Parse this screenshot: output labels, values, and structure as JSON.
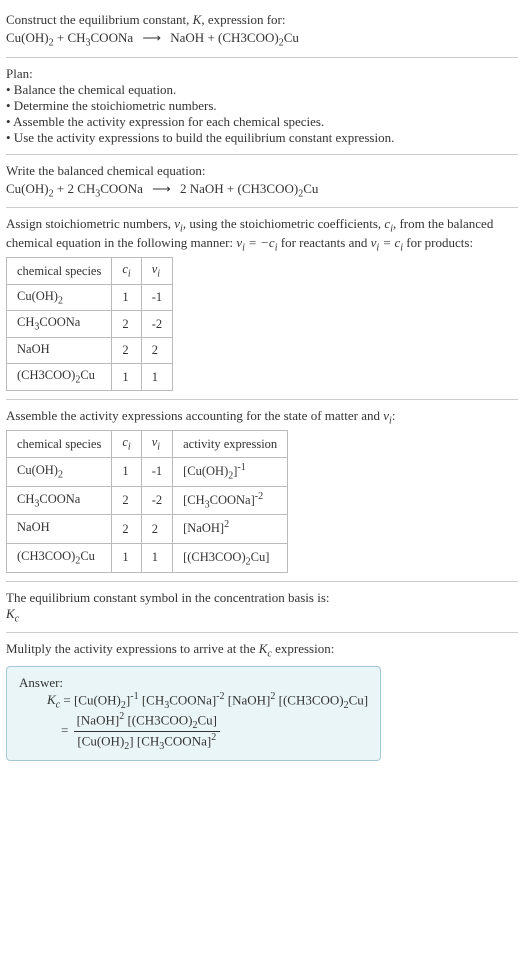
{
  "header": {
    "line1_a": "Construct the equilibrium constant, ",
    "line1_b": ", expression for:"
  },
  "eq1": {
    "lhs1": "Cu(OH)",
    "lhs1_sub": "2",
    "plus1": " + ",
    "lhs2": "CH",
    "lhs2_sub": "3",
    "lhs2b": "COONa",
    "arrow": "⟶",
    "rhs1": "NaOH + (CH3COO)",
    "rhs1_sub": "2",
    "rhs1b": "Cu"
  },
  "plan_title": "Plan:",
  "plan_items": {
    "a": "• Balance the chemical equation.",
    "b": "• Determine the stoichiometric numbers.",
    "c": "• Assemble the activity expression for each chemical species.",
    "d": "• Use the activity expressions to build the equilibrium constant expression."
  },
  "balanced_title": "Write the balanced chemical equation:",
  "eq2": {
    "lhs1": "Cu(OH)",
    "lhs1_sub": "2",
    "plus1": " + 2 CH",
    "lhs2_sub": "3",
    "lhs2b": "COONa",
    "arrow": "⟶",
    "rhs": "2 NaOH + (CH3COO)",
    "rhs_sub": "2",
    "rhsb": "Cu"
  },
  "assign_text_a": "Assign stoichiometric numbers, ",
  "assign_text_b": ", using the stoichiometric coefficients, ",
  "assign_text_c": ", from the balanced chemical equation in the following manner: ",
  "assign_text_d": " for reactants and ",
  "assign_text_e": " for products:",
  "table1": {
    "h1": "chemical species",
    "h2": "c",
    "h2_sub": "i",
    "h3": "ν",
    "h3_sub": "i",
    "rows": [
      {
        "sp_a": "Cu(OH)",
        "sp_sub": "2",
        "sp_b": "",
        "c": "1",
        "v": "-1"
      },
      {
        "sp_a": "CH",
        "sp_sub": "3",
        "sp_b": "COONa",
        "c": "2",
        "v": "-2"
      },
      {
        "sp_a": "NaOH",
        "sp_sub": "",
        "sp_b": "",
        "c": "2",
        "v": "2"
      },
      {
        "sp_a": "(CH3COO)",
        "sp_sub": "2",
        "sp_b": "Cu",
        "c": "1",
        "v": "1"
      }
    ]
  },
  "activity_title_a": "Assemble the activity expressions accounting for the state of matter and ",
  "activity_title_b": ":",
  "table2": {
    "h1": "chemical species",
    "h4": "activity expression",
    "rows": [
      {
        "sp_a": "Cu(OH)",
        "sp_sub": "2",
        "sp_b": "",
        "c": "1",
        "v": "-1",
        "act_a": "[Cu(OH)",
        "act_sub": "2",
        "act_b": "]",
        "exp": "-1"
      },
      {
        "sp_a": "CH",
        "sp_sub": "3",
        "sp_b": "COONa",
        "c": "2",
        "v": "-2",
        "act_a": "[CH",
        "act_sub": "3",
        "act_b": "COONa]",
        "exp": "-2"
      },
      {
        "sp_a": "NaOH",
        "sp_sub": "",
        "sp_b": "",
        "c": "2",
        "v": "2",
        "act_a": "[NaOH]",
        "act_sub": "",
        "act_b": "",
        "exp": "2"
      },
      {
        "sp_a": "(CH3COO)",
        "sp_sub": "2",
        "sp_b": "Cu",
        "c": "1",
        "v": "1",
        "act_a": "[(CH3COO)",
        "act_sub": "2",
        "act_b": "Cu]",
        "exp": ""
      }
    ]
  },
  "basis_line": "The equilibrium constant symbol in the concentration basis is:",
  "Kc": "K",
  "Kc_sub": "c",
  "multiply_line_a": "Mulitply the activity expressions to arrive at the ",
  "multiply_line_b": " expression:",
  "answer_label": "Answer:",
  "answer": {
    "eq_pre": " = [Cu(OH)",
    "p1_sub": "2",
    "p1b": "]",
    "p1_exp": "-1",
    "p2a": " [CH",
    "p2_sub": "3",
    "p2b": "COONa]",
    "p2_exp": "-2",
    "p3a": " [NaOH]",
    "p3_exp": "2",
    "p4a": " [(CH3COO)",
    "p4_sub": "2",
    "p4b": "Cu]",
    "eq2_pre": "= ",
    "num_a": "[NaOH]",
    "num_exp": "2",
    "num_b": " [(CH3COO)",
    "num_sub": "2",
    "num_c": "Cu]",
    "den_a": "[Cu(OH)",
    "den_sub": "2",
    "den_b": "] [CH",
    "den_sub2": "3",
    "den_c": "COONa]",
    "den_exp": "2"
  }
}
